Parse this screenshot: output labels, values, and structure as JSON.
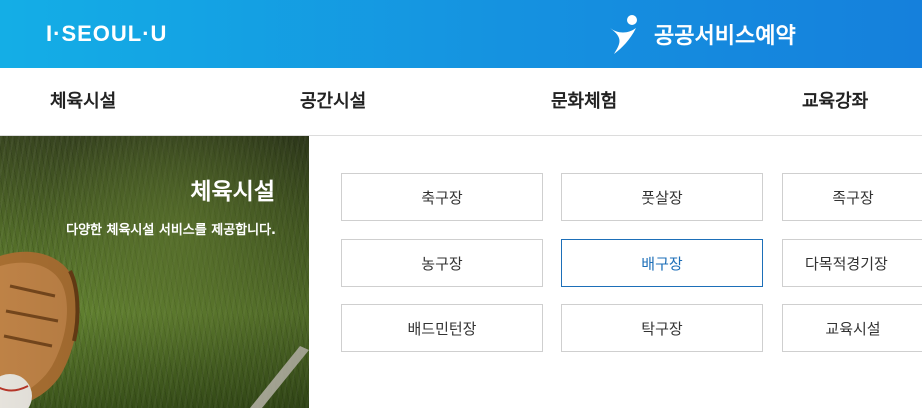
{
  "header": {
    "logo": "I·SEOUL·U",
    "brand_icon": "person-swoosh-icon",
    "brand_text": "공공서비스예약"
  },
  "nav": {
    "items": [
      "체육시설",
      "공간시설",
      "문화체험",
      "교육강좌"
    ]
  },
  "hero": {
    "title": "체육시설",
    "subtitle": "다양한 체육시설 서비스를 제공합니다."
  },
  "facilities": [
    [
      "축구장",
      "풋살장",
      "족구장"
    ],
    [
      "농구장",
      "배구장",
      "다목적경기장"
    ],
    [
      "배드민턴장",
      "탁구장",
      "교육시설"
    ]
  ],
  "selected_facility": "배구장",
  "colors": {
    "header_start": "#14aee6",
    "header_end": "#1580dc",
    "active": "#1d6fb8",
    "border": "#cfcfcf"
  }
}
